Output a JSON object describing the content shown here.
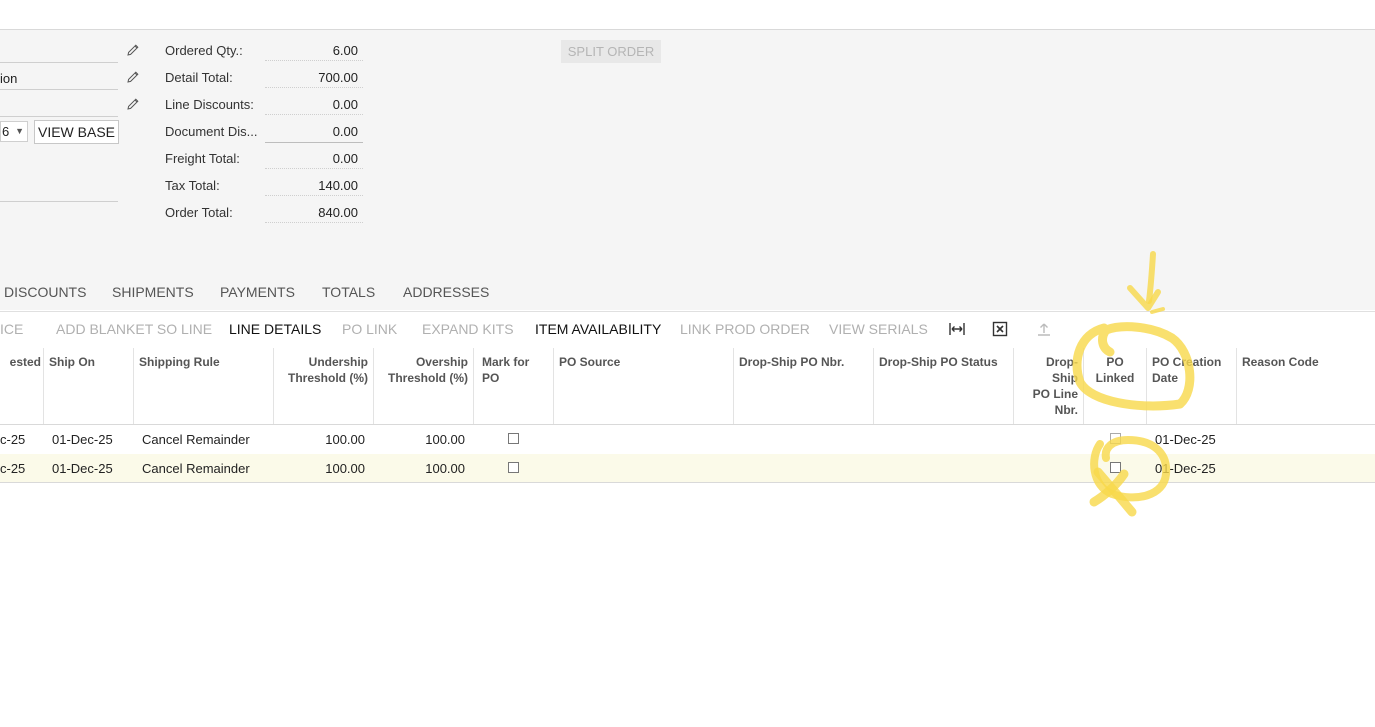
{
  "summary": {
    "ordered_qty_label": "Ordered Qty.:",
    "ordered_qty": "6.00",
    "detail_total_label": "Detail Total:",
    "detail_total": "700.00",
    "line_discounts_label": "Line Discounts:",
    "line_discounts": "0.00",
    "document_discounts_label": "Document Dis...",
    "document_discounts": "0.00",
    "freight_total_label": "Freight Total:",
    "freight_total": "0.00",
    "tax_total_label": "Tax Total:",
    "tax_total": "140.00",
    "order_total_label": "Order Total:",
    "order_total": "840.00"
  },
  "left_form": {
    "field2_value": "ion",
    "combo_value": "6",
    "view_base_label": "VIEW BASE"
  },
  "split_order_label": "SPLIT ORDER",
  "tabs": [
    "DISCOUNTS",
    "SHIPMENTS",
    "PAYMENTS",
    "TOTALS",
    "ADDRESSES"
  ],
  "toolbar": {
    "items": [
      "ICE",
      "ADD BLANKET SO LINE",
      "LINE DETAILS",
      "PO LINK",
      "EXPAND KITS",
      "ITEM AVAILABILITY",
      "LINK PROD ORDER",
      "VIEW SERIALS"
    ],
    "active": [
      "LINE DETAILS",
      "ITEM AVAILABILITY"
    ],
    "icons": [
      "fit-columns-icon",
      "export-excel-icon",
      "upload-icon"
    ]
  },
  "columns": {
    "requested": "ested",
    "ship_on": "Ship On",
    "shipping_rule": "Shipping Rule",
    "undership": "Undership Threshold (%)",
    "overship": "Overship Threshold (%)",
    "mark_for_po": "Mark for PO",
    "po_source": "PO Source",
    "dropship_po_nbr": "Drop-Ship PO Nbr.",
    "dropship_po_status": "Drop-Ship PO Status",
    "dropship_po_line_nbr": "Drop-Ship PO Line Nbr.",
    "po_linked": "PO Linked",
    "po_creation_date": "PO Creation Date",
    "reason_code": "Reason Code"
  },
  "rows": [
    {
      "requested": "c-25",
      "ship_on": "01-Dec-25",
      "shipping_rule": "Cancel Remainder",
      "undership": "100.00",
      "overship": "100.00",
      "mark_for_po": false,
      "po_linked": false,
      "po_creation_date": "01-Dec-25"
    },
    {
      "requested": "c-25",
      "ship_on": "01-Dec-25",
      "shipping_rule": "Cancel Remainder",
      "undership": "100.00",
      "overship": "100.00",
      "mark_for_po": false,
      "po_linked": false,
      "po_creation_date": "01-Dec-25"
    }
  ],
  "colors": {
    "selected_row": "#fbfae9",
    "annotation": "#f7d84a",
    "header_bg": "#f5f5f5"
  }
}
